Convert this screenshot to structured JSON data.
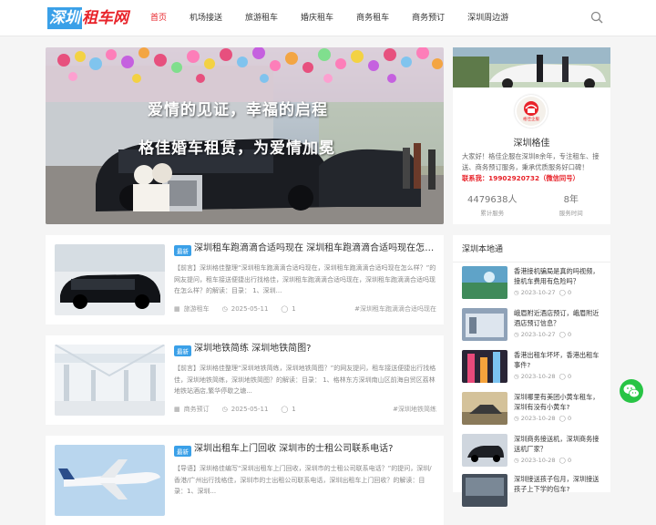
{
  "header": {
    "logo_part1": "深圳",
    "logo_part2": "租车网",
    "nav": [
      "首页",
      "机场接送",
      "旅游租车",
      "婚庆租车",
      "商务租车",
      "商务预订",
      "深圳周边游"
    ]
  },
  "banner": {
    "line1": "爱情的见证，幸福的启程",
    "line2": "格佳婚车租赁，为爱情加冕"
  },
  "profile": {
    "badge": "格佳企服",
    "name": "深圳格佳",
    "desc": "大家好！格佳企服在深圳8余年，专注租车、接送、商务预订服务，秉承优质服务好口碑！",
    "phone_line": "联系我：19902920732（微信同号）",
    "stats": [
      {
        "value": "4479638人",
        "label": "累计服务"
      },
      {
        "value": "8年",
        "label": "服务时间"
      }
    ]
  },
  "posts": [
    {
      "tag": "最新",
      "title": "深圳租车跑滴滴合适吗现在 深圳租车跑滴滴合适吗现在怎么样?",
      "excerpt": "【前言】深圳格佳整理“深圳租车跑滴滴合适吗现在，深圳租车跑滴滴合适吗现在怎么样？”的网友提问，租车接送便捷出行找格佳，深圳租车跑滴滴合适吗现在，深圳租车跑滴滴合适吗现在怎么样？的解读：目录： 1、深圳...",
      "category": "旅游租车",
      "date": "2025-05-11",
      "comments": "1",
      "keyword": "#深圳租车跑滴滴合适吗现在"
    },
    {
      "tag": "最新",
      "title": "深圳地铁简练 深圳地铁简图?",
      "excerpt": "【前言】深圳格佳整理“深圳地铁简练，深圳地铁简图？”的网友提问，租车接送便捷出行找格佳，深圳地铁简练，深圳地铁简图？的解读：目录： 1、格林东方深圳南山区前海自贸区荔林地铁站酒店,繁华停歇之塘...",
      "category": "商务预订",
      "date": "2025-05-11",
      "comments": "1",
      "keyword": "#深圳地铁简练"
    },
    {
      "tag": "最新",
      "title": "深圳出租车上门回收 深圳市的士租公司联系电话?",
      "excerpt": "【导语】深圳格佳编写“深圳出租车上门回收，深圳市的士租公司联系电话？”的提问，深圳/香港/广州出行找格佳，深圳市的士出租公司联系电话，深圳出租车上门回收？的解读：目录：1、深圳...",
      "category": "",
      "date": "",
      "comments": "",
      "keyword": ""
    }
  ],
  "sidebar": {
    "title": "深圳本地通",
    "items": [
      {
        "title": "香港接机骗局是真的吗视频，接机车费用有危险吗？",
        "date": "2023-10-27",
        "comments": "0"
      },
      {
        "title": "峨眉附近酒店预订，峨眉附近酒店预订信息？",
        "date": "2023-10-27",
        "comments": "0"
      },
      {
        "title": "香港出租车坏坏，香港出租车事件?",
        "date": "2023-10-28",
        "comments": "0"
      },
      {
        "title": "深圳哪里有美团小黄车租车，深圳有没有小黄车?",
        "date": "2023-10-28",
        "comments": "0"
      },
      {
        "title": "深圳商务接送机，深圳商务接送机厂家？",
        "date": "2023-10-28",
        "comments": "0"
      },
      {
        "title": "深圳接送孩子包月，深圳接送孩子上下学的包车?",
        "date": "",
        "comments": ""
      }
    ]
  },
  "colors": {
    "accent": "#e8232a",
    "tag": "#3aa0e8",
    "wechat": "#28c445"
  }
}
